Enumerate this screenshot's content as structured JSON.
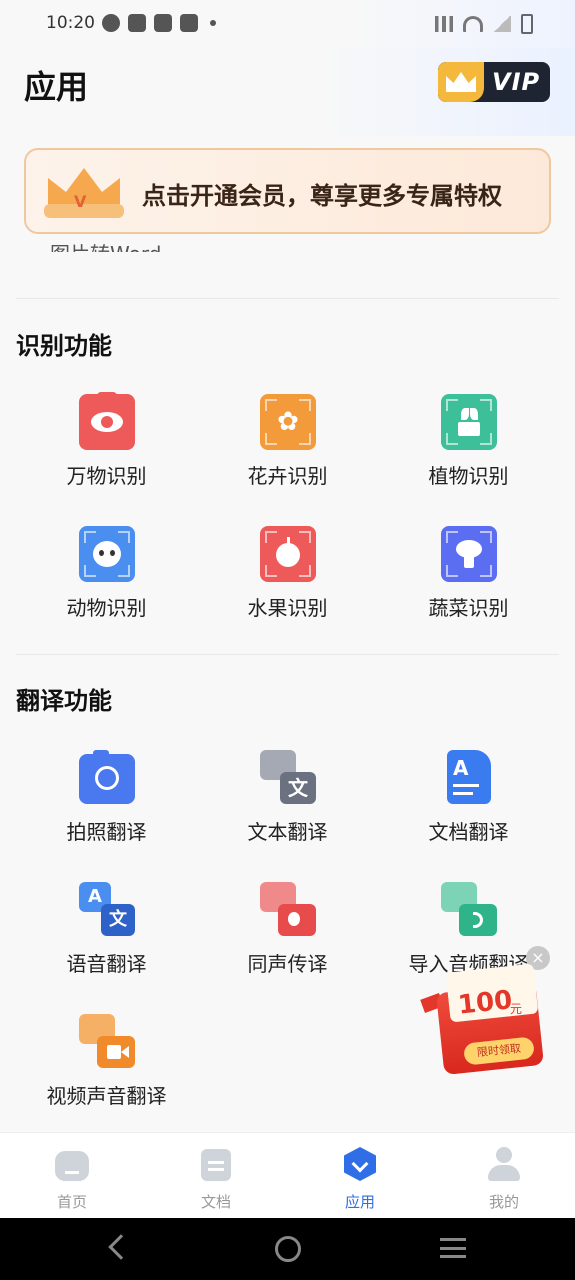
{
  "status_bar": {
    "time": "10:20"
  },
  "header": {
    "title": "应用",
    "vip_label": "VIP"
  },
  "banner": {
    "text": "点击开通会员，尊享更多专属特权"
  },
  "partial_text": "图片转Word",
  "sections": [
    {
      "title": "识别功能",
      "items": [
        {
          "label": "万物识别",
          "icon": "eye-icon",
          "color": "#ee5a5a"
        },
        {
          "label": "花卉识别",
          "icon": "flower-icon",
          "color": "#f39a3a"
        },
        {
          "label": "植物识别",
          "icon": "plant-icon",
          "color": "#3dbf9a"
        },
        {
          "label": "动物识别",
          "icon": "panda-icon",
          "color": "#4a8ff0"
        },
        {
          "label": "水果识别",
          "icon": "apple-icon",
          "color": "#ee5a5a"
        },
        {
          "label": "蔬菜识别",
          "icon": "vegetable-icon",
          "color": "#5b6ef2"
        }
      ]
    },
    {
      "title": "翻译功能",
      "items": [
        {
          "label": "拍照翻译",
          "icon": "camera-translate-icon",
          "color": "#4a78ee"
        },
        {
          "label": "文本翻译",
          "icon": "text-translate-icon",
          "color": "#7b8190",
          "glyph": "文"
        },
        {
          "label": "文档翻译",
          "icon": "document-translate-icon",
          "color": "#3a7cf0",
          "glyph": "A"
        },
        {
          "label": "语音翻译",
          "icon": "voice-translate-icon",
          "color": "#3a7cf0",
          "glyph": "A文"
        },
        {
          "label": "同声传译",
          "icon": "simultaneous-interpretation-icon",
          "color": "#e84b4b"
        },
        {
          "label": "导入音频翻译",
          "icon": "audio-import-translate-icon",
          "color": "#2fb489"
        },
        {
          "label": "视频声音翻译",
          "icon": "video-translate-icon",
          "color": "#f08a2a"
        }
      ]
    }
  ],
  "red_packet": {
    "amount": "100",
    "unit": "元",
    "button": "限时领取",
    "close": "×"
  },
  "tabs": [
    {
      "label": "首页",
      "icon": "home-icon"
    },
    {
      "label": "文档",
      "icon": "document-icon"
    },
    {
      "label": "应用",
      "icon": "apps-icon",
      "active": true
    },
    {
      "label": "我的",
      "icon": "profile-icon"
    }
  ],
  "colors": {
    "accent": "#2f6ee6",
    "banner_text": "#3a2418"
  }
}
